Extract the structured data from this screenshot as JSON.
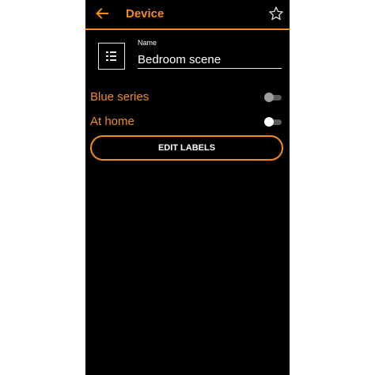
{
  "header": {
    "back_icon": "arrow-left-icon",
    "title": "Device",
    "star_icon": "star-outline-icon"
  },
  "device": {
    "icon": "list-icon",
    "name_label": "Name",
    "name_value": "Bedroom scene"
  },
  "toggles": [
    {
      "label": "Blue series",
      "on": false,
      "thumb_color": "#9e9e9e"
    },
    {
      "label": "At home",
      "on": false,
      "thumb_color": "#ffffff"
    }
  ],
  "actions": {
    "edit_labels": "EDIT LABELS"
  },
  "colors": {
    "accent": "#f28c1a",
    "background": "#000000",
    "text": "#ffffff"
  }
}
